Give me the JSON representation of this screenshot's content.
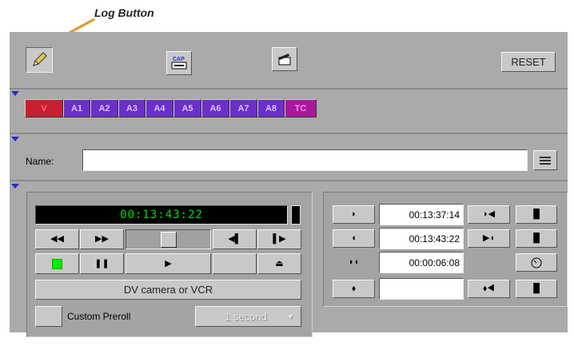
{
  "callout": {
    "label": "Log Button"
  },
  "toolbar": {
    "log_icon": "pencil-icon",
    "capture_icon": "cap-deck-icon",
    "clapper_icon": "clapperboard-icon",
    "reset_label": "RESET"
  },
  "tracks": [
    "V",
    "A1",
    "A2",
    "A3",
    "A4",
    "A5",
    "A6",
    "A7",
    "A8",
    "TC"
  ],
  "name_row": {
    "label": "Name:",
    "value": ""
  },
  "deck": {
    "timecode": "00:13:43:22",
    "device": "DV camera or VCR",
    "custom_preroll_label": "Custom Preroll",
    "preroll_value": "1 second"
  },
  "marks": {
    "mark_in": "00:13:37:14",
    "mark_out": "00:13:43:22",
    "duration": "00:00:06:08",
    "extra": ""
  },
  "colors": {
    "record_indicator": "#00ee00",
    "arrow": "#f0902a",
    "video_track": "#c81e32",
    "audio_track": "#6a30c8",
    "tc_track": "#a8189c"
  }
}
